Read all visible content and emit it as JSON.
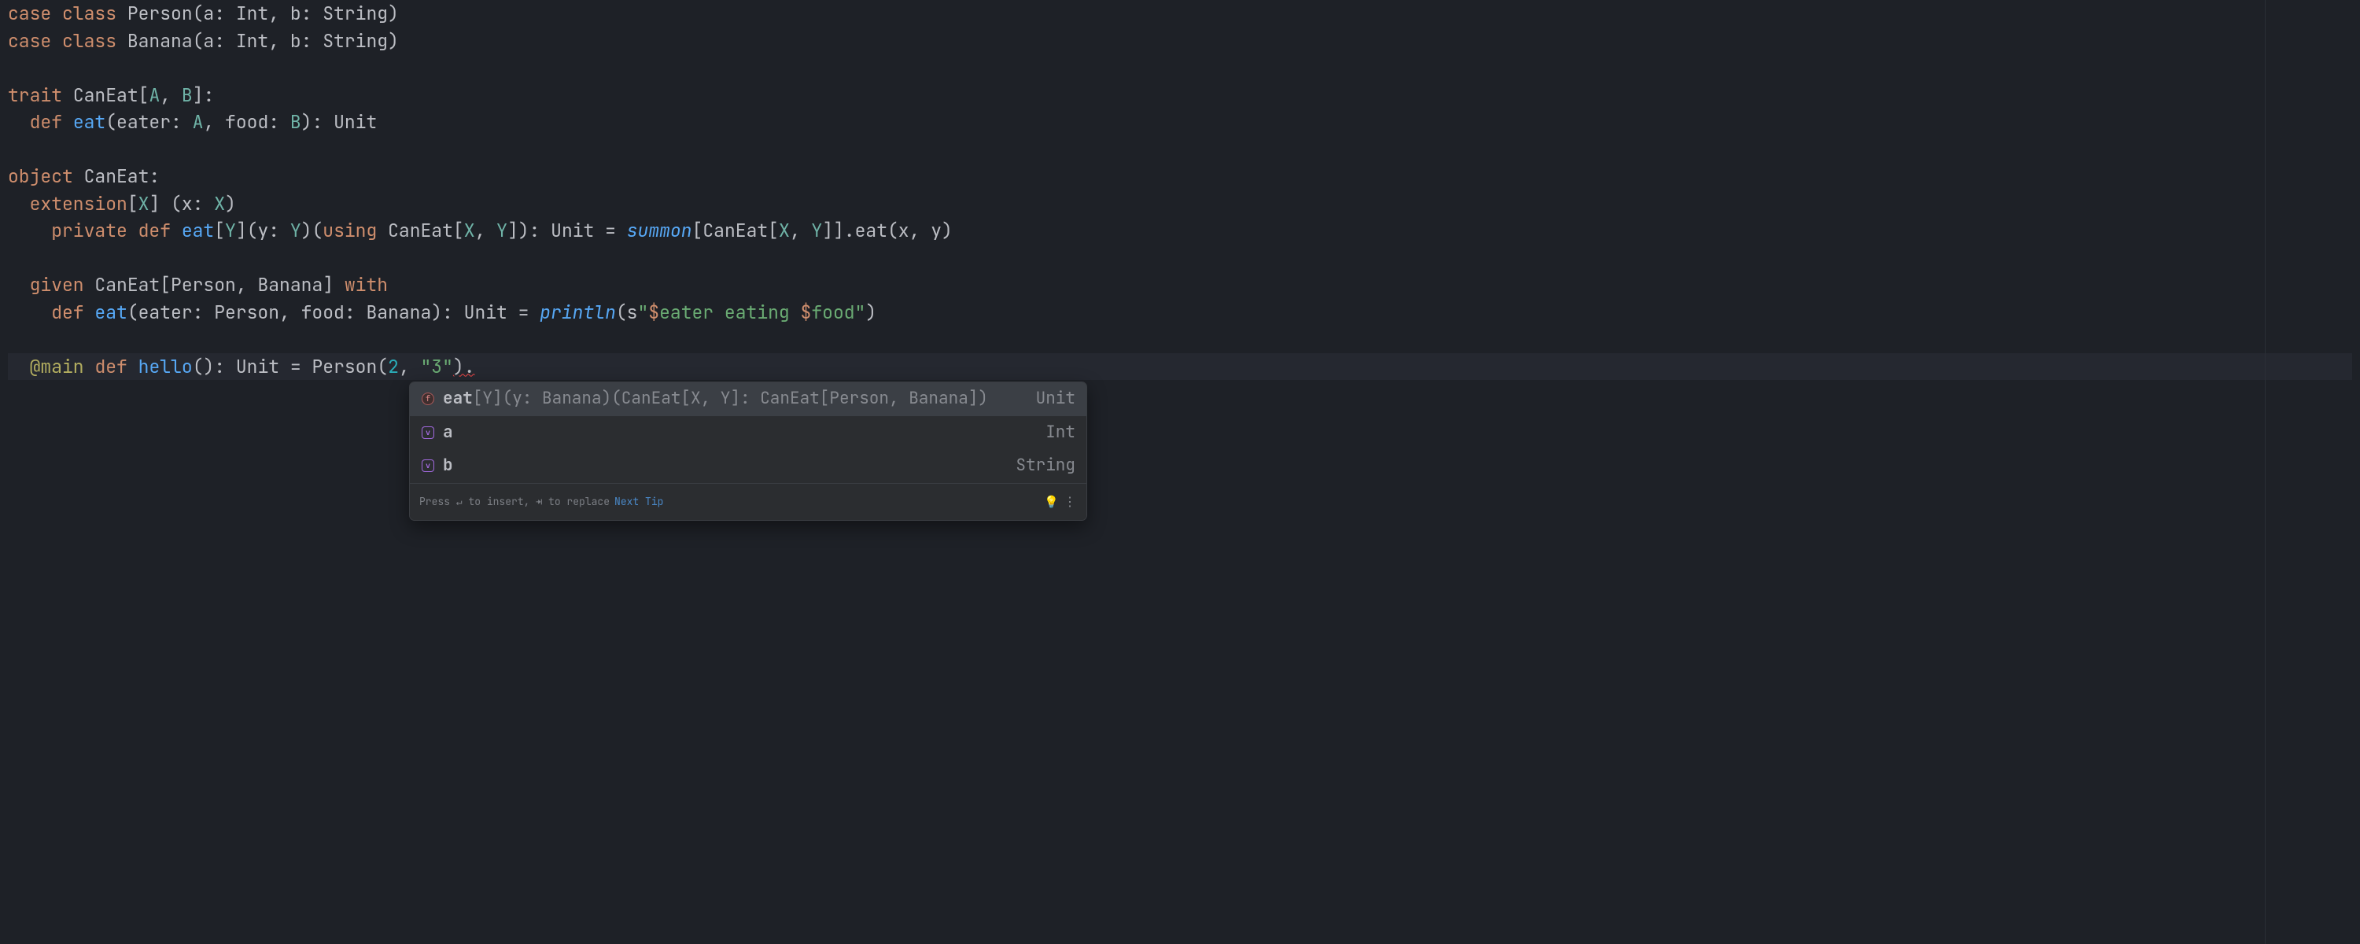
{
  "code": {
    "l1": {
      "kw": "case class ",
      "name": "Person",
      "sigPre": "(a: ",
      "t1": "Int",
      "mid": ", b: ",
      "t2": "String",
      "close": ")"
    },
    "l2": {
      "kw": "case class ",
      "name": "Banana",
      "sigPre": "(a: ",
      "t1": "Int",
      "mid": ", b: ",
      "t2": "String",
      "close": ")"
    },
    "l4": {
      "kw": "trait ",
      "name": "CanEat",
      "open": "[",
      "A": "A",
      "c": ", ",
      "B": "B",
      "close": "]:"
    },
    "l5": {
      "indent": "  ",
      "kw": "def ",
      "name": "eat",
      "sig": "(eater: ",
      "A": "A",
      "mid": ", food: ",
      "B": "B",
      "close": "): ",
      "ret": "Unit"
    },
    "l7": {
      "kw": "object ",
      "name": "CanEat",
      "colon": ":"
    },
    "l8": {
      "indent": "  ",
      "kw": "extension",
      "open": "[",
      "X": "X",
      "close": "] (x: ",
      "Xp": "X",
      ")": ")"
    },
    "l9": {
      "indent": "    ",
      "kw1": "private def ",
      "name": "eat",
      "open": "[",
      "Y": "Y",
      "mid": "](y: ",
      "Yp": "Y",
      "p2": ")(",
      "using": "using ",
      "ce": "CanEat[",
      "X": "X",
      "c": ", ",
      "Y2": "Y",
      "ret": "]): ",
      "unit": "Unit",
      "eq": " = ",
      "summon": "summon",
      "b": "[CanEat[",
      "X2": "X",
      "c2": ", ",
      "Y3": "Y",
      "call": "]].eat(x, y)"
    },
    "l11": {
      "indent": "  ",
      "kw": "given ",
      "ce": "CanEat[",
      "P": "Person",
      "c": ", ",
      "Ba": "Banana",
      "close": "] ",
      "with": "with"
    },
    "l12": {
      "indent": "    ",
      "kw": "def ",
      "name": "eat",
      "sig": "(eater: ",
      "P": "Person",
      "mid": ", food: ",
      "Ba": "Banana",
      "ret": "): ",
      "unit": "Unit",
      "eq": " = ",
      "fn": "println",
      "open": "(s",
      "q": "\"",
      "d1": "$",
      "v1": "eater",
      "t": " eating ",
      "d2": "$",
      "v2": "food",
      "q2": "\"",
      ")": ")"
    },
    "l14": {
      "indent": "  ",
      "ann": "@main",
      "sp": " ",
      "kw": "def ",
      "name": "hello",
      "sig": "(): ",
      "unit": "Unit",
      "eq": " = Person(",
      "n": "2",
      "c": ", ",
      "s": "\"3\"",
      "dot": ")."
    }
  },
  "errGlyph": "∼",
  "popup": {
    "rows": [
      {
        "icon": "f",
        "label": "eat",
        "sig": "[Y](y: Banana)(CanEat[X, Y]: CanEat[Person, Banana])",
        "ret": "Unit",
        "selected": true
      },
      {
        "icon": "v",
        "label": "a",
        "sig": "",
        "ret": "Int",
        "selected": false
      },
      {
        "icon": "v",
        "label": "b",
        "sig": "",
        "ret": "String",
        "selected": false
      }
    ],
    "footer": {
      "hint": "Press ↵ to insert, ⇥ to replace",
      "link": "Next Tip",
      "bulb": "💡",
      "more": "⋮"
    }
  }
}
